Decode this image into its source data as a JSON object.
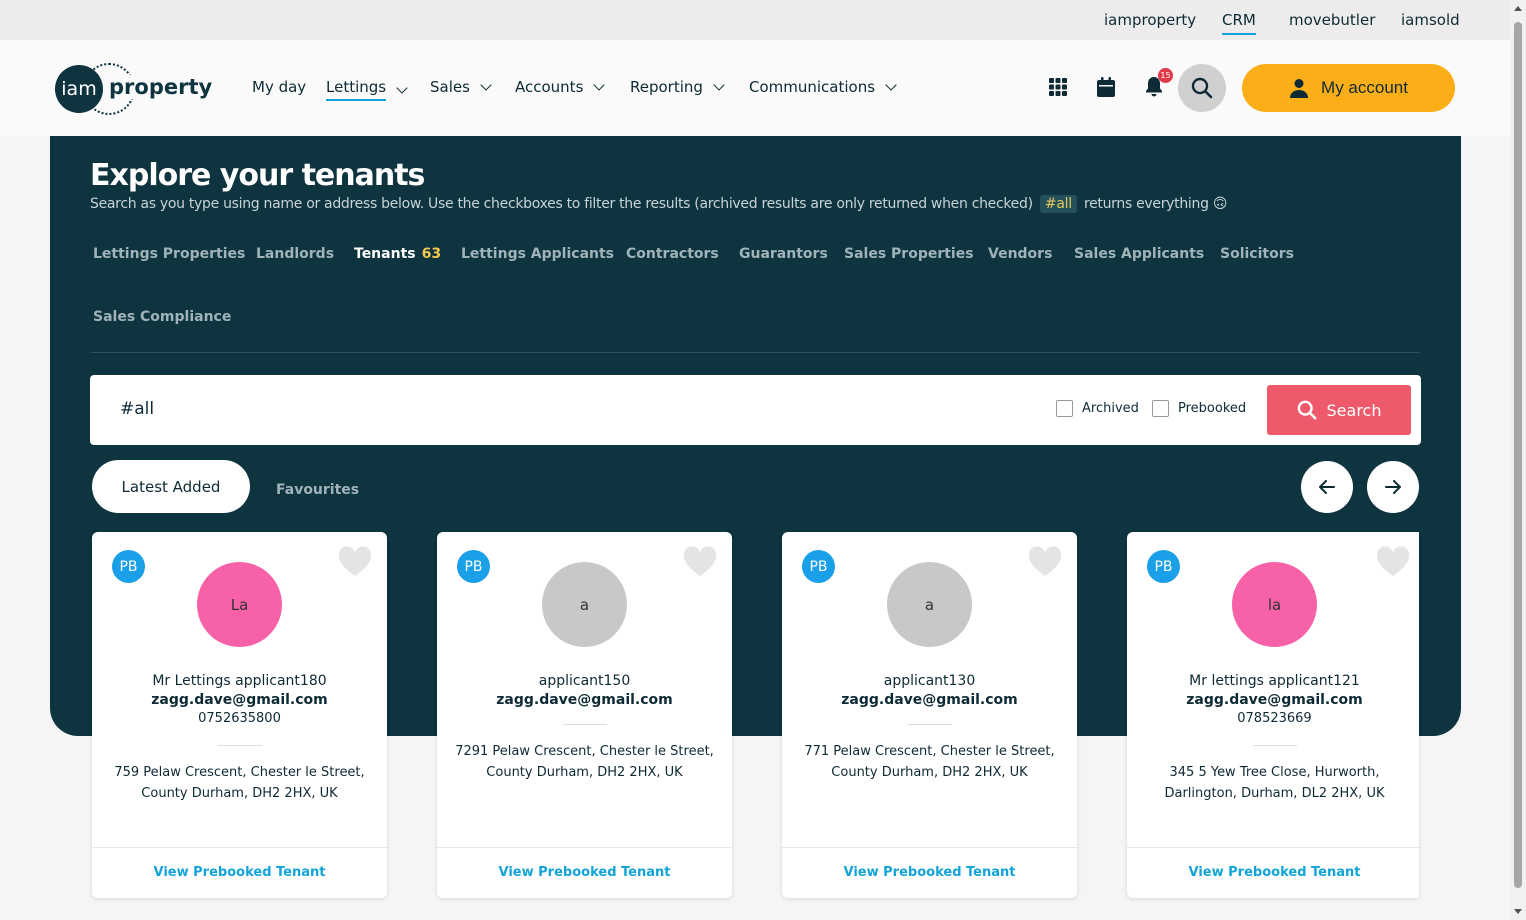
{
  "topbar": {
    "links": [
      {
        "label": "iamproperty",
        "active": false
      },
      {
        "label": "CRM",
        "active": true
      },
      {
        "label": "movebutler",
        "active": false
      },
      {
        "label": "iamsold",
        "active": false
      }
    ]
  },
  "header": {
    "logo": {
      "circle": "iam",
      "word": "property"
    },
    "nav": [
      {
        "label": "My day",
        "dropdown": false,
        "active": false
      },
      {
        "label": "Lettings",
        "dropdown": true,
        "active": true
      },
      {
        "label": "Sales",
        "dropdown": true,
        "active": false
      },
      {
        "label": "Accounts",
        "dropdown": true,
        "active": false
      },
      {
        "label": "Reporting",
        "dropdown": true,
        "active": false
      },
      {
        "label": "Communications",
        "dropdown": true,
        "active": false
      }
    ],
    "notification_count": "15",
    "account_label": "My account"
  },
  "hero": {
    "title_plain": "Explore your ",
    "title_bold": "tenants",
    "subtitle_before": "Search as you type using name or address below. Use the checkboxes to filter the results (archived results are only returned when checked)",
    "subtitle_tag": "#all",
    "subtitle_after": "returns everything 🙃",
    "tabs": [
      {
        "label": "Lettings Properties",
        "active": false
      },
      {
        "label": "Landlords",
        "active": false
      },
      {
        "label": "Tenants",
        "active": true,
        "count": "63"
      },
      {
        "label": "Lettings Applicants",
        "active": false
      },
      {
        "label": "Contractors",
        "active": false
      },
      {
        "label": "Guarantors",
        "active": false
      },
      {
        "label": "Sales Properties",
        "active": false
      },
      {
        "label": "Vendors",
        "active": false
      },
      {
        "label": "Sales Applicants",
        "active": false
      },
      {
        "label": "Solicitors",
        "active": false
      },
      {
        "label": "Sales Compliance",
        "active": false
      }
    ]
  },
  "search": {
    "query": "#all",
    "archived_label": "Archived",
    "archived_checked": false,
    "prebooked_label": "Prebooked",
    "prebooked_checked": false,
    "button_label": "Search"
  },
  "filters": {
    "latest_label": "Latest Added",
    "favourites_label": "Favourites"
  },
  "cards": [
    {
      "badge": "PB",
      "initials": "La",
      "avatar_color": "#f661a8",
      "name": "Mr Lettings applicant180",
      "email": "zagg.dave@gmail.com",
      "phone": "0752635800",
      "address_line1": "759 Pelaw Crescent, Chester le Street,",
      "address_line2": "County Durham, DH2 2HX, UK",
      "link": "View Prebooked Tenant"
    },
    {
      "badge": "PB",
      "initials": "a",
      "avatar_color": "#c8c8c8",
      "name": "applicant150",
      "email": "zagg.dave@gmail.com",
      "phone": "",
      "address_line1": "7291 Pelaw Crescent, Chester le Street,",
      "address_line2": "County Durham, DH2 2HX, UK",
      "link": "View Prebooked Tenant"
    },
    {
      "badge": "PB",
      "initials": "a",
      "avatar_color": "#c8c8c8",
      "name": "applicant130",
      "email": "zagg.dave@gmail.com",
      "phone": "",
      "address_line1": "771 Pelaw Crescent, Chester le Street,",
      "address_line2": "County Durham, DH2 2HX, UK",
      "link": "View Prebooked Tenant"
    },
    {
      "badge": "PB",
      "initials": "la",
      "avatar_color": "#f661a8",
      "name": "Mr lettings applicant121",
      "email": "zagg.dave@gmail.com",
      "phone": "078523669",
      "address_line1": "345 5 Yew Tree Close, Hurworth,",
      "address_line2": "Darlington, Durham, DL2 2HX, UK",
      "link": "View Prebooked Tenant"
    }
  ],
  "colors": {
    "brand_dark": "#0e3440",
    "accent_yellow": "#fbae17",
    "search_red": "#ee5a6c",
    "link_blue": "#12a4d8"
  }
}
